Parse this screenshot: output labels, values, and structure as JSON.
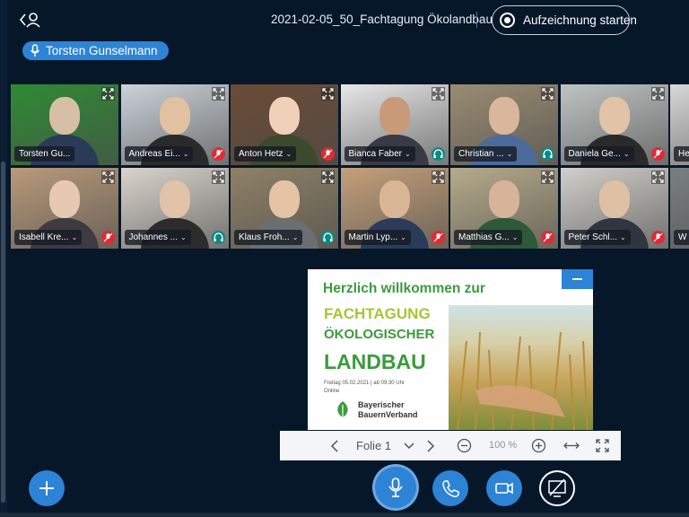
{
  "header": {
    "meeting_title": "2021-02-05_50_Fachtagung Ökolandbau",
    "record_label": "Aufzeichnung starten",
    "users_icon": "users-toggle-icon"
  },
  "talking_indicator": {
    "name": "Torsten Gunselmann",
    "icon": "microphone-icon"
  },
  "participants": [
    {
      "name": "Torsten Gu...",
      "status": "none"
    },
    {
      "name": "Andreas Ei...",
      "status": "muted"
    },
    {
      "name": "Anton Hetz",
      "status": "muted"
    },
    {
      "name": "Bianca Faber",
      "status": "listen"
    },
    {
      "name": "Christian ...",
      "status": "listen"
    },
    {
      "name": "Daniela Ge...",
      "status": "muted"
    },
    {
      "name": "He",
      "status": "none"
    },
    {
      "name": "Isabell Kre...",
      "status": "muted"
    },
    {
      "name": "Johannes ...",
      "status": "listen"
    },
    {
      "name": "Klaus Froh...",
      "status": "listen"
    },
    {
      "name": "Martin Lyp...",
      "status": "muted"
    },
    {
      "name": "Matthias G...",
      "status": "muted"
    },
    {
      "name": "Peter Schl...",
      "status": "muted"
    },
    {
      "name": "W",
      "status": "none"
    }
  ],
  "slide": {
    "title": "Herzlich willkommen zur",
    "line1": "FACHTAGUNG",
    "line2": "ÖKOLOGISCHER",
    "line3": "LANDBAU",
    "date": "Freitag 05.02.2021 | ab 09:30 Uhr",
    "online": "Online",
    "org_line1": "Bayerischer",
    "org_line2": "BauernVerband"
  },
  "presentation_toolbar": {
    "prev_icon": "chevron-left-icon",
    "slide_label": "Folie 1",
    "slide_dropdown_icon": "chevron-down-icon",
    "next_icon": "chevron-right-icon",
    "zoom_out_icon": "minus-circle-icon",
    "zoom_level": "100 %",
    "zoom_in_icon": "plus-circle-icon",
    "fit_width_icon": "fit-width-icon",
    "fullscreen_icon": "fullscreen-icon"
  },
  "colors": {
    "background": "#06172a",
    "accent": "#2d83d5",
    "muted": "#df2b35",
    "listen": "#0a8a84",
    "slide_green": "#3a9b3c",
    "slide_lime": "#a6c531"
  }
}
